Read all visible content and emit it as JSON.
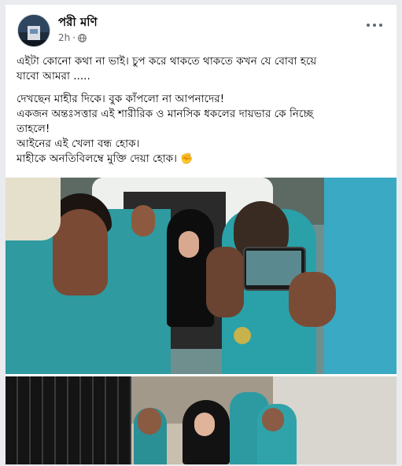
{
  "post": {
    "author": "পরী মণি",
    "time": "2h",
    "dot": "·",
    "privacy_icon": "globe-icon",
    "menu_icon": "more-options-icon",
    "lines": [
      "এইটা কোনো কথা না ভাই। চুপ করে থাকতে থাকতে কখন যে বোবা হয়ে",
      "যাবো আমরা .....",
      "",
      "দেখছেন মাহীর দিকে। বুক কাঁপলো না আপনাদের!",
      "একজন অন্তঃসত্তার এই শারীরিক ও মানসিক ধকলের দায়ভার কে নিচ্ছে",
      "তাহলে!",
      "আইনের এই খেলা বন্ধ হোক।",
      "মাহীকে অনতিবিলম্বে মুক্তি দেয়া হোক।"
    ],
    "emoji": "✊"
  },
  "images": [
    {
      "name": "photo-police-van"
    },
    {
      "name": "photo-corridor"
    }
  ]
}
